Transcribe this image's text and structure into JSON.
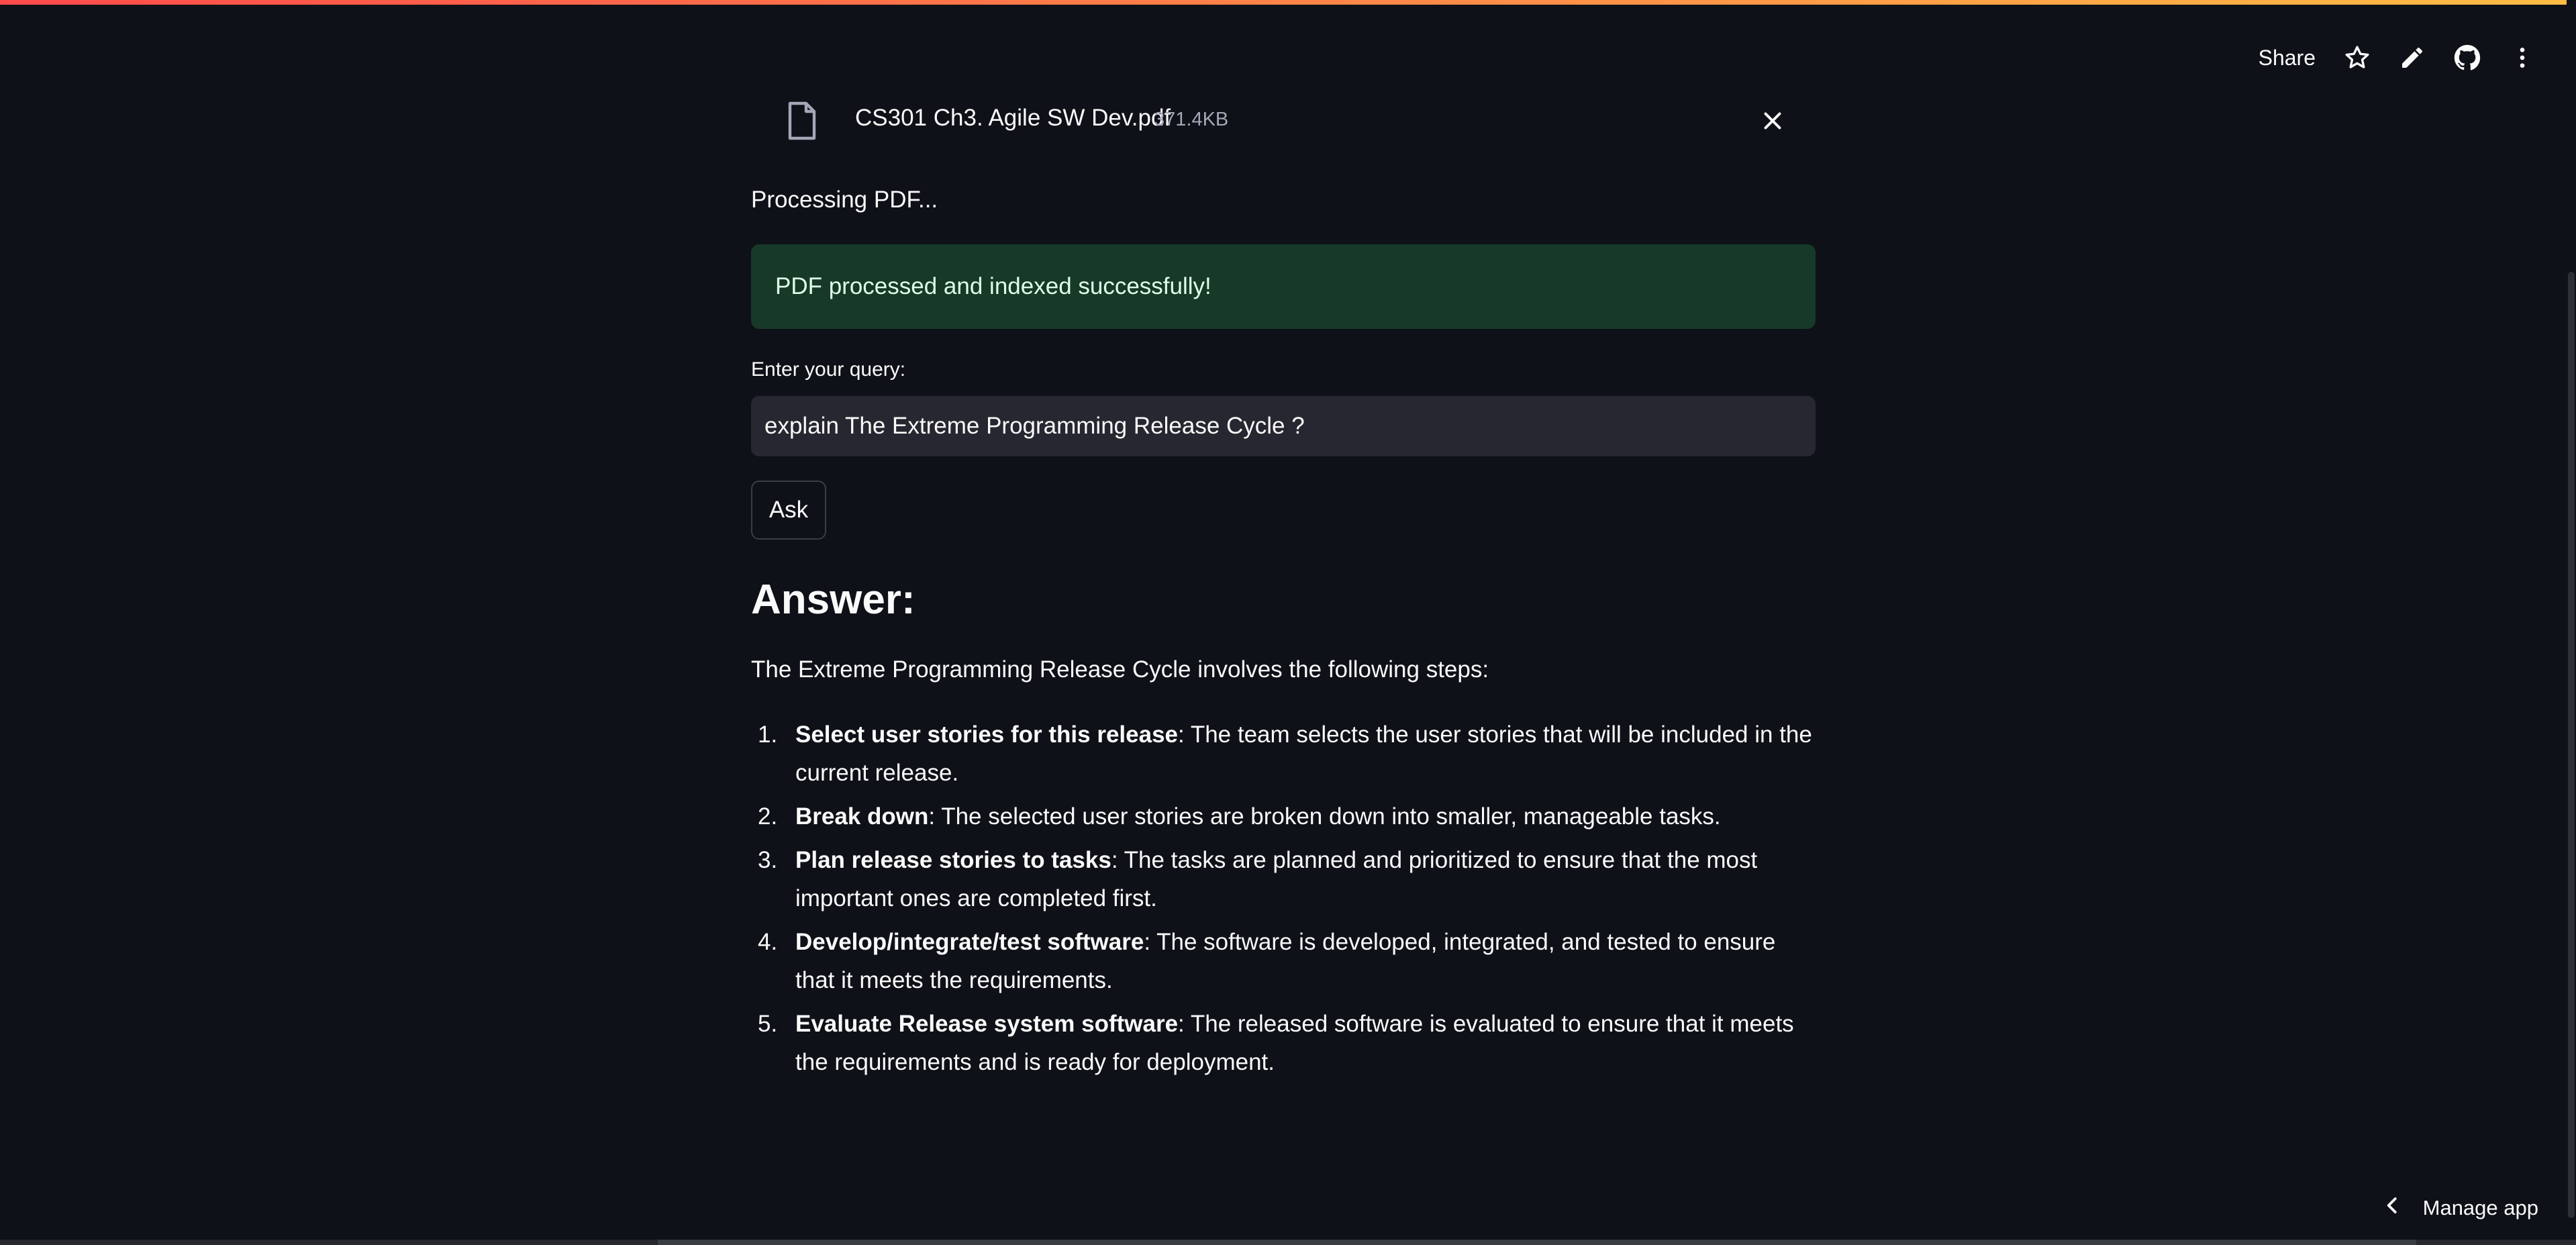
{
  "toolbar": {
    "share_label": "Share",
    "icons": [
      "star-icon",
      "pencil-icon",
      "github-icon",
      "more-vert-icon"
    ]
  },
  "file": {
    "name": "CS301 Ch3. Agile SW Dev.pdf",
    "size": "371.4KB"
  },
  "status": {
    "processing": "Processing PDF...",
    "success": "PDF processed and indexed successfully!"
  },
  "query": {
    "label": "Enter your query:",
    "value": "explain The Extreme Programming Release Cycle ?"
  },
  "ask_label": "Ask",
  "answer": {
    "heading": "Answer:",
    "intro": "The Extreme Programming Release Cycle involves the following steps:",
    "steps": [
      {
        "num": "1.",
        "title": "Select user stories for this release",
        "text": ": The team selects the user stories that will be included in the current release."
      },
      {
        "num": "2.",
        "title": "Break down",
        "text": ": The selected user stories are broken down into smaller, manageable tasks."
      },
      {
        "num": "3.",
        "title": "Plan release stories to tasks",
        "text": ": The tasks are planned and prioritized to ensure that the most important ones are completed first."
      },
      {
        "num": "4.",
        "title": "Develop/integrate/test software",
        "text": ": The software is developed, integrated, and tested to ensure that it meets the requirements."
      },
      {
        "num": "5.",
        "title": "Evaluate Release system software",
        "text": ": The released software is evaluated to ensure that it meets the requirements and is ready for deployment."
      }
    ]
  },
  "manage_app_label": "Manage app",
  "colors": {
    "background": "#0e1117",
    "success_bg": "#173928",
    "input_bg": "#262730",
    "accent_gradient_start": "#ff4b4b",
    "accent_gradient_end": "#ffbd45"
  }
}
